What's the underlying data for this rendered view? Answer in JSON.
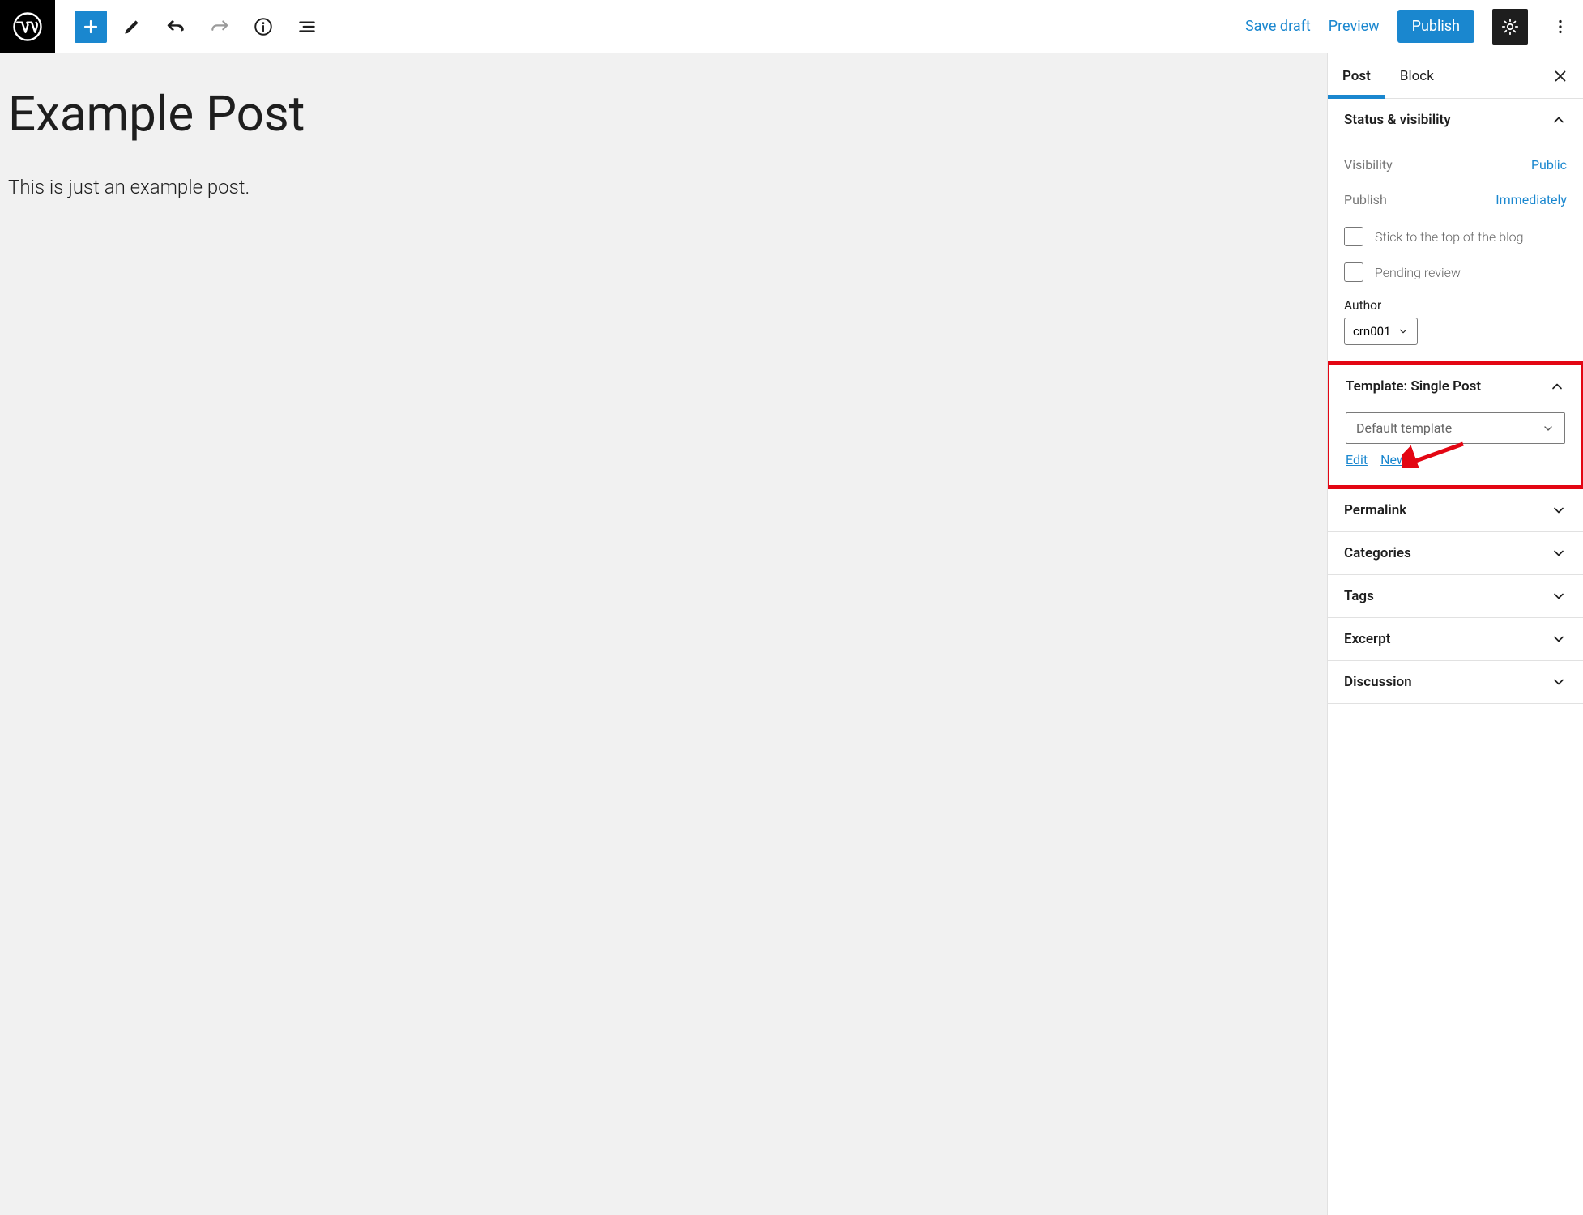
{
  "topbar": {
    "save_draft": "Save draft",
    "preview": "Preview",
    "publish": "Publish"
  },
  "editor": {
    "title": "Example Post",
    "body": "This is just an example post."
  },
  "sidebar": {
    "tabs": {
      "post": "Post",
      "block": "Block",
      "active": "post"
    },
    "panels": {
      "status": {
        "title": "Status & visibility",
        "visibility_label": "Visibility",
        "visibility_value": "Public",
        "publish_label": "Publish",
        "publish_value": "Immediately",
        "stick_label": "Stick to the top of the blog",
        "pending_label": "Pending review",
        "author_label": "Author",
        "author_value": "crn001"
      },
      "template": {
        "title": "Template: Single Post",
        "select_value": "Default template",
        "edit": "Edit",
        "new": "New"
      },
      "permalink": {
        "title": "Permalink"
      },
      "categories": {
        "title": "Categories"
      },
      "tags": {
        "title": "Tags"
      },
      "excerpt": {
        "title": "Excerpt"
      },
      "discussion": {
        "title": "Discussion"
      }
    }
  },
  "icons": {
    "wp": "wordpress-logo",
    "plus": "plus-icon",
    "pencil": "edit-icon",
    "undo": "undo-icon",
    "redo": "redo-icon",
    "info": "info-icon",
    "outline": "outline-icon",
    "gear": "settings-icon",
    "kebab": "more-vertical-icon",
    "close": "close-icon",
    "chev_up": "chevron-up-icon",
    "chev_down": "chevron-down-icon"
  },
  "annotation": {
    "highlight_panel": "template",
    "arrow_target": "template-new-link"
  }
}
